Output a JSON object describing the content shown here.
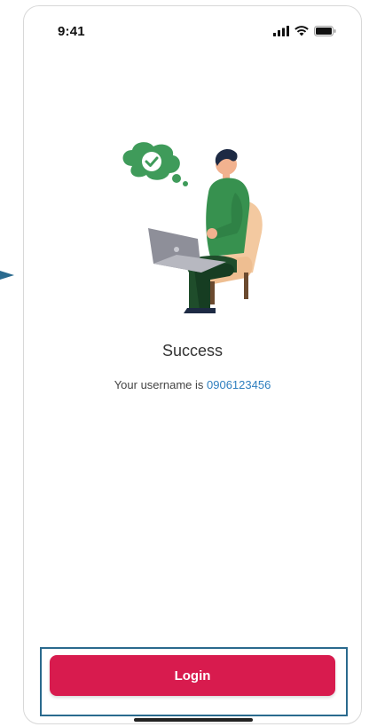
{
  "status_bar": {
    "time": "9:41",
    "icons": [
      "signal-icon",
      "wifi-icon",
      "battery-icon"
    ]
  },
  "illustration": {
    "icon": "success-person-illustration",
    "bubble_icon": "checkmark-icon",
    "bubble_color": "#3f9b5a"
  },
  "content": {
    "title": "Success",
    "message_prefix": "Your username is ",
    "username": "0906123456"
  },
  "actions": {
    "login_label": "Login",
    "login_color": "#d81b4e"
  },
  "annotation": {
    "arrow_color": "#2a6a8e",
    "highlight_color": "#2a6a8e"
  }
}
